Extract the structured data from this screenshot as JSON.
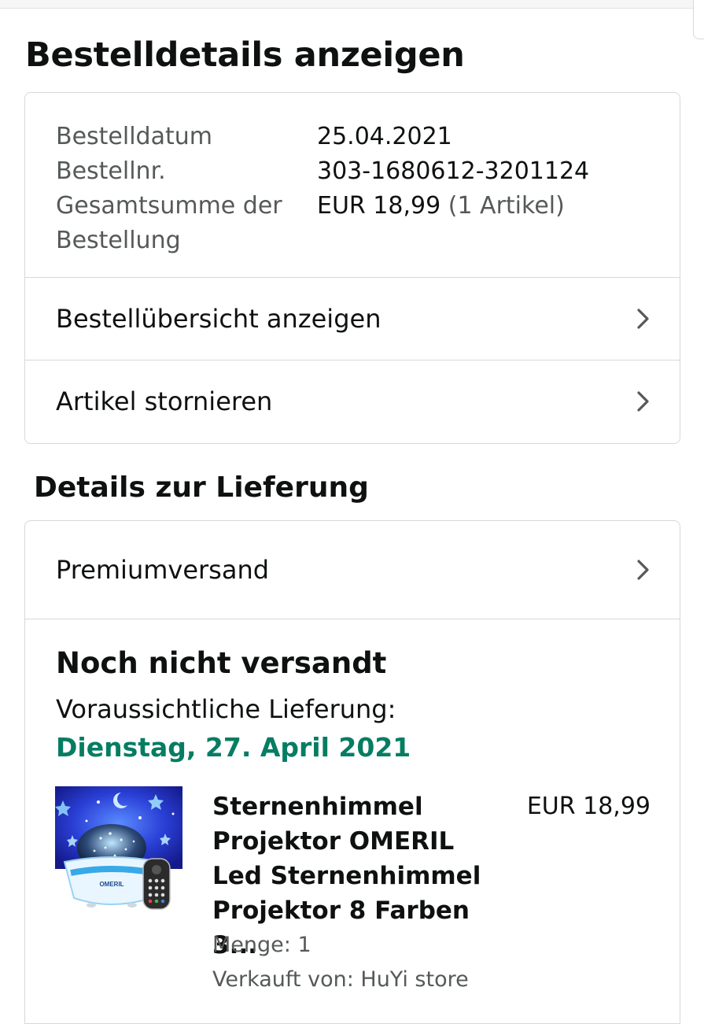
{
  "page": {
    "title": "Bestelldetails anzeigen"
  },
  "order_info": {
    "date_label": "Bestelldatum",
    "date_value": "25.04.2021",
    "number_label": "Bestellnr.",
    "number_value": "303-1680612-3201124",
    "total_label_line1": "Gesamtsumme der",
    "total_label_line2": "Bestellung",
    "total_value": "EUR 18,99",
    "total_items": "(1 Artikel)"
  },
  "actions": {
    "view_summary": "Bestellübersicht anzeigen",
    "cancel_items": "Artikel stornieren"
  },
  "delivery": {
    "heading": "Details zur Lieferung",
    "shipping_method": "Premiumversand",
    "status": "Noch nicht versandt",
    "expected_label": "Voraussichtliche Lieferung:",
    "expected_date": "Dienstag, 27. April 2021"
  },
  "product": {
    "title": "Sternenhimmel Projektor OMERIL Led Sternenhimmel Projektor 8 Farben 3...",
    "price": "EUR 18,99",
    "quantity": "Menge: 1",
    "seller": "Verkauft von: HuYi store",
    "image_brand": "OMERIL"
  },
  "colors": {
    "delivery_date_green": "#067d62",
    "muted_text": "#565959",
    "border": "#d5d9d9"
  }
}
